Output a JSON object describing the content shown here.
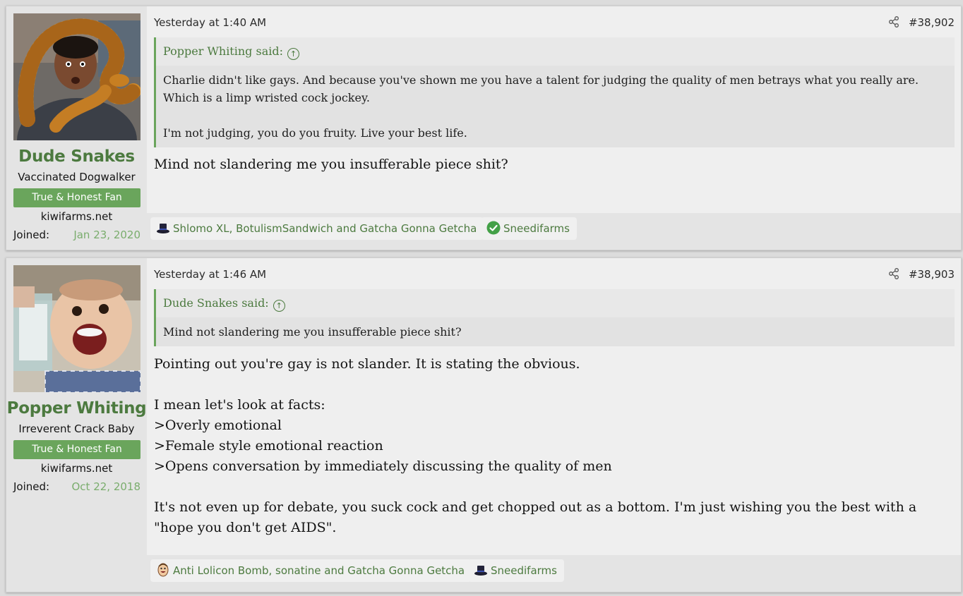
{
  "posts": [
    {
      "author": "Dude Snakes",
      "user_title": "Vaccinated Dogwalker",
      "banner": "True & Honest Fan",
      "site": "kiwifarms.net",
      "joined_label": "Joined:",
      "joined_date": "Jan 23, 2020",
      "date": "Yesterday at 1:40 AM",
      "post_number": "#38,902",
      "quote_author": "Popper Whiting said:",
      "quote_lines": [
        "Charlie didn't like gays. And because you've shown me you have a talent for judging the quality of men betrays what you really are. Which is a limp wristed cock jockey.",
        "I'm not judging, you do you fruity. Live your best life."
      ],
      "body": [
        "Mind not slandering me you insufferable piece shit?"
      ],
      "reactions": [
        {
          "icon": "top-hat-icon",
          "text": "Shlomo XL, BotulismSandwich and Gatcha Gonna Getcha"
        },
        {
          "icon": "check-circle-icon",
          "text": "Sneedifarms"
        }
      ]
    },
    {
      "author": "Popper Whiting",
      "user_title": "Irreverent Crack Baby",
      "banner": "True & Honest Fan",
      "site": "kiwifarms.net",
      "joined_label": "Joined:",
      "joined_date": "Oct 22, 2018",
      "date": "Yesterday at 1:46 AM",
      "post_number": "#38,903",
      "quote_author": "Dude Snakes said:",
      "quote_lines": [
        "Mind not slandering me you insufferable piece shit?"
      ],
      "body": [
        "Pointing out you're gay is not slander. It is stating the obvious.",
        "",
        "I mean let's look at facts:",
        ">Overly emotional",
        ">Female style emotional reaction",
        ">Opens conversation by immediately discussing the quality of men",
        "",
        "It's not even up for debate, you suck cock and get chopped out as a bottom. I'm just wishing you the best with a \"hope you don't get AIDS\"."
      ],
      "reactions": [
        {
          "icon": "laughing-face-icon",
          "text": "Anti Lolicon Bomb, sonatine and Gatcha Gonna Getcha"
        },
        {
          "icon": "top-hat-icon",
          "text": "Sneedifarms"
        }
      ]
    }
  ],
  "colors": {
    "accent": "#4c7a3f",
    "banner": "#6aa55c",
    "joined": "#7aad6d"
  }
}
